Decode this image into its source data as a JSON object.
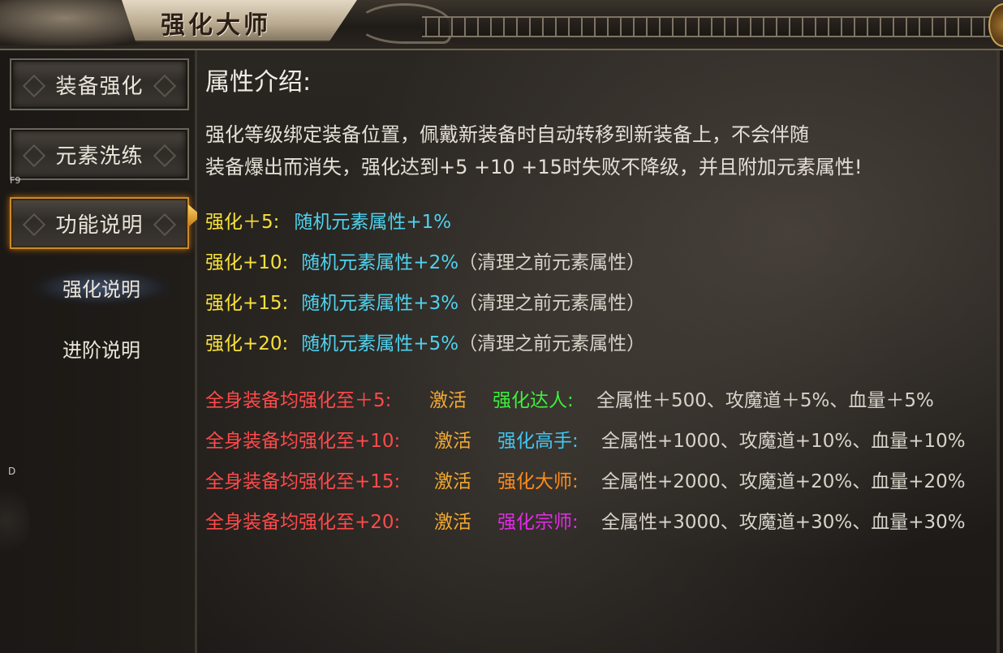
{
  "window": {
    "title": "强化大师"
  },
  "sidebar": {
    "buttons": [
      {
        "label": "装备强化"
      },
      {
        "label": "元素洗练"
      },
      {
        "label": "功能说明"
      }
    ],
    "sub_items": [
      {
        "label": "强化说明"
      },
      {
        "label": "进阶说明"
      }
    ],
    "hotkeys": {
      "f9": "F9",
      "d": "D"
    }
  },
  "content": {
    "heading": "属性介绍:",
    "paragraph_lines": [
      "强化等级绑定装备位置，佩戴新装备时自动转移到新装备上，不会伴随",
      "装备爆出而消失，强化达到+5 +10 +15时失败不降级，并且附加元素属性!"
    ],
    "level_rows": [
      {
        "level": "强化＋5:",
        "effect": "随机元素属性+1%",
        "note": ""
      },
      {
        "level": "强化+10:",
        "effect": "随机元素属性+2%",
        "note": "（清理之前元素属性）"
      },
      {
        "level": "强化+15:",
        "effect": "随机元素属性+3%",
        "note": "（清理之前元素属性）"
      },
      {
        "level": "强化+20:",
        "effect": "随机元素属性+5%",
        "note": "（清理之前元素属性）"
      }
    ],
    "set_rows": [
      {
        "condition": "全身装备均强化至＋5:",
        "activate": "激活",
        "title": "强化达人:",
        "bonus": "全属性＋500、攻魔道＋5%、血量＋5%",
        "title_color": "#3cf03c"
      },
      {
        "condition": "全身装备均强化至+10:",
        "activate": "激活",
        "title": "强化高手:",
        "bonus": "全属性+1000、攻魔道+10%、血量+10%",
        "title_color": "#3fc6f2"
      },
      {
        "condition": "全身装备均强化至+15:",
        "activate": "激活",
        "title": "强化大师:",
        "bonus": "全属性+2000、攻魔道+20%、血量+20%",
        "title_color": "#ff8c1a"
      },
      {
        "condition": "全身装备均强化至+20:",
        "activate": "激活",
        "title": "强化宗师:",
        "bonus": "全属性+3000、攻魔道+30%、血量+30%",
        "title_color": "#e22ce6"
      }
    ]
  }
}
